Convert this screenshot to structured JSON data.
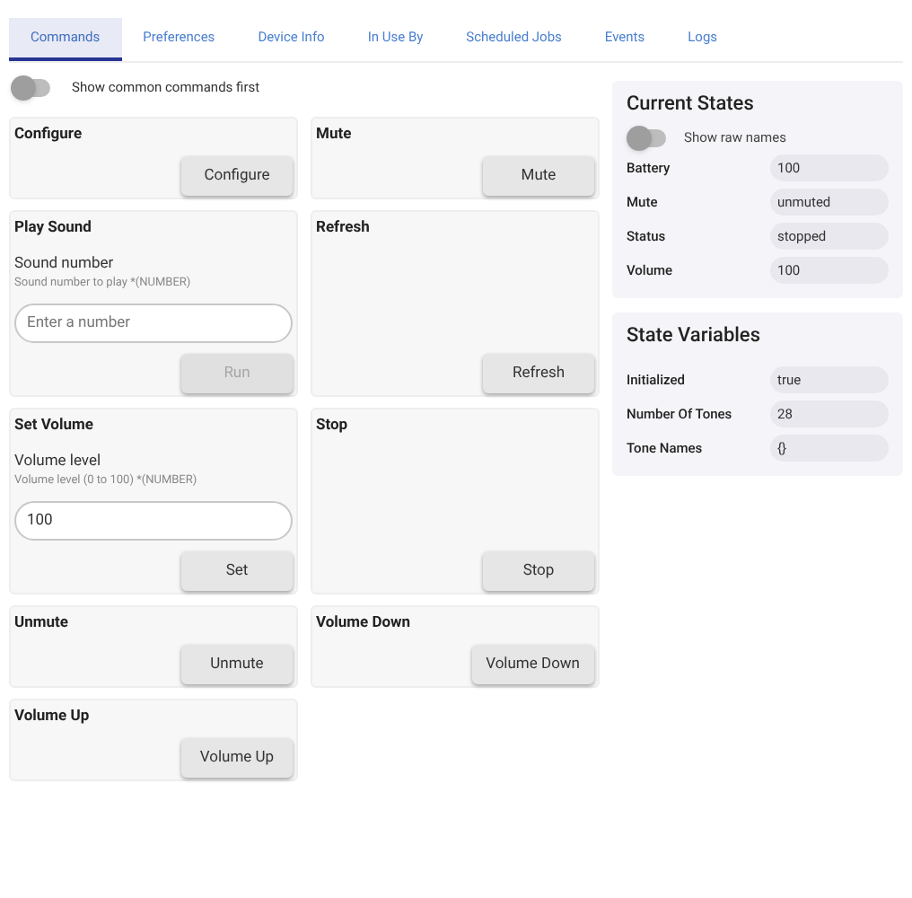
{
  "tabs": [
    {
      "label": "Commands",
      "selected": true
    },
    {
      "label": "Preferences",
      "selected": false
    },
    {
      "label": "Device Info",
      "selected": false
    },
    {
      "label": "In Use By",
      "selected": false
    },
    {
      "label": "Scheduled Jobs",
      "selected": false
    },
    {
      "label": "Events",
      "selected": false
    },
    {
      "label": "Logs",
      "selected": false
    }
  ],
  "common_toggle": {
    "label": "Show common commands first",
    "on": false
  },
  "commands": [
    {
      "kind": "simple",
      "title": "Configure",
      "button": {
        "label": "Configure",
        "disabled": false
      }
    },
    {
      "kind": "simple",
      "title": "Mute",
      "button": {
        "label": "Mute",
        "disabled": false
      }
    },
    {
      "kind": "input",
      "title": "Play Sound",
      "field_label": "Sound number",
      "hint": "Sound number to play *(NUMBER)",
      "placeholder": "Enter a number",
      "button": {
        "label": "Run",
        "disabled": true
      }
    },
    {
      "kind": "simple",
      "title": "Refresh",
      "button": {
        "label": "Refresh",
        "disabled": false
      }
    },
    {
      "kind": "input",
      "title": "Set Volume",
      "field_label": "Volume level",
      "hint": "Volume level (0 to 100) *(NUMBER)",
      "value": "100",
      "button": {
        "label": "Set",
        "disabled": false
      }
    },
    {
      "kind": "simple",
      "title": "Stop",
      "button": {
        "label": "Stop",
        "disabled": false
      }
    },
    {
      "kind": "simple",
      "title": "Unmute",
      "button": {
        "label": "Unmute",
        "disabled": false
      }
    },
    {
      "kind": "simple",
      "title": "Volume Down",
      "button": {
        "label": "Volume Down",
        "disabled": false
      }
    },
    {
      "kind": "simple",
      "title": "Volume Up",
      "button": {
        "label": "Volume Up",
        "disabled": false
      }
    }
  ],
  "current_states": {
    "title": "Current States",
    "raw_toggle": {
      "label": "Show raw names",
      "on": false
    },
    "rows": [
      {
        "name": "Battery",
        "value": "100"
      },
      {
        "name": "Mute",
        "value": "unmuted"
      },
      {
        "name": "Status",
        "value": "stopped"
      },
      {
        "name": "Volume",
        "value": "100"
      }
    ]
  },
  "state_variables": {
    "title": "State Variables",
    "rows": [
      {
        "name": "Initialized",
        "value": "true"
      },
      {
        "name": "Number Of Tones",
        "value": "28"
      },
      {
        "name": "Tone Names",
        "value": "{}"
      }
    ]
  }
}
